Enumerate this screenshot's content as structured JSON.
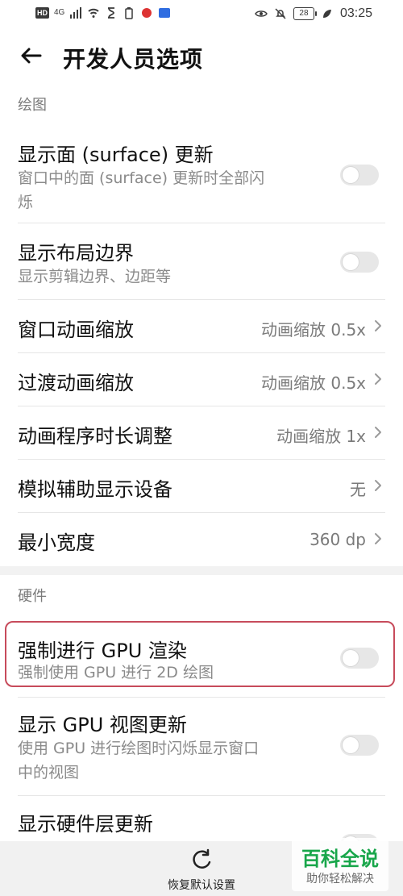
{
  "status_bar": {
    "hd": "HD",
    "network": "4G",
    "battery": "28",
    "time": "03:25",
    "icons": [
      "signal-icon",
      "wifi-icon",
      "hourglass-icon",
      "battery-small-icon",
      "app-icon-1",
      "app-icon-2",
      "eye-icon",
      "bell-off-icon",
      "leaf-icon"
    ]
  },
  "header": {
    "title": "开发人员选项",
    "back_icon": "arrow-left-icon"
  },
  "sections": {
    "drawing": {
      "header": "绘图",
      "items": [
        {
          "label": "显示面 (surface) 更新",
          "sub1": "窗口中的面 (surface) 更新时全部闪",
          "sub2": "烁",
          "control": "toggle",
          "state": "off"
        },
        {
          "label": "显示布局边界",
          "sub1": "显示剪辑边界、边距等",
          "control": "toggle",
          "state": "off"
        },
        {
          "label": "窗口动画缩放",
          "value": "动画缩放 0.5x",
          "control": "select"
        },
        {
          "label": "过渡动画缩放",
          "value": "动画缩放 0.5x",
          "control": "select"
        },
        {
          "label": "动画程序时长调整",
          "value": "动画缩放 1x",
          "control": "select"
        },
        {
          "label": "模拟辅助显示设备",
          "value": "无",
          "control": "select"
        },
        {
          "label": "最小宽度",
          "value": "360 dp",
          "control": "select"
        }
      ]
    },
    "hardware": {
      "header": "硬件",
      "items": [
        {
          "label": "强制进行 GPU 渲染",
          "sub1": "强制使用 GPU 进行 2D 绘图",
          "control": "toggle",
          "state": "off",
          "highlighted": true
        },
        {
          "label": "显示 GPU 视图更新",
          "sub1": "使用 GPU 进行绘图时闪烁显示窗口",
          "sub2": "中的视图",
          "control": "toggle",
          "state": "off"
        },
        {
          "label": "显示硬件层更新",
          "control": "toggle",
          "state": "off"
        }
      ]
    }
  },
  "bottom_bar": {
    "reset_label": "恢复默认设置",
    "reset_icon": "refresh-icon"
  },
  "watermark": {
    "main": "百科全说",
    "sub": "助你轻松解决"
  },
  "colors": {
    "highlight": "#c74b5b",
    "toggle_off": "#e7e7e7",
    "watermark_green": "#18a64a"
  }
}
